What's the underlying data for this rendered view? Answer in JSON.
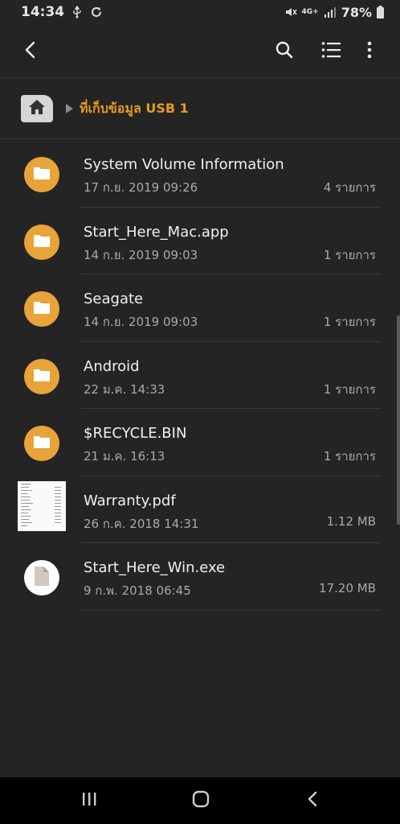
{
  "status_bar": {
    "time": "14:34",
    "network": "4G+",
    "battery": "78%"
  },
  "toolbar": {
    "icons": [
      "back-arrow-icon",
      "search-icon",
      "list-view-icon",
      "more-vert-icon"
    ]
  },
  "breadcrumb": {
    "location": "ที่เก็บข้อมูล USB 1",
    "accent": "#e89a1f"
  },
  "files": [
    {
      "name": "System Volume Information",
      "date": "17 ก.ย. 2019 09:26",
      "meta": "4 รายการ",
      "type": "folder"
    },
    {
      "name": "Start_Here_Mac.app",
      "date": "14 ก.ย. 2019 09:03",
      "meta": "1 รายการ",
      "type": "folder"
    },
    {
      "name": "Seagate",
      "date": "14 ก.ย. 2019 09:03",
      "meta": "1 รายการ",
      "type": "folder"
    },
    {
      "name": "Android",
      "date": "22 ม.ค. 14:33",
      "meta": "1 รายการ",
      "type": "folder"
    },
    {
      "name": "$RECYCLE.BIN",
      "date": "21 ม.ค. 16:13",
      "meta": "1 รายการ",
      "type": "folder"
    },
    {
      "name": "Warranty.pdf",
      "date": "26 ก.ค. 2018 14:31",
      "meta": "1.12 MB",
      "type": "pdf"
    },
    {
      "name": "Start_Here_Win.exe",
      "date": "9 ก.พ. 2018 06:45",
      "meta": "17.20 MB",
      "type": "file"
    }
  ],
  "colors": {
    "folder": "#e8a43a",
    "background": "#242424"
  }
}
